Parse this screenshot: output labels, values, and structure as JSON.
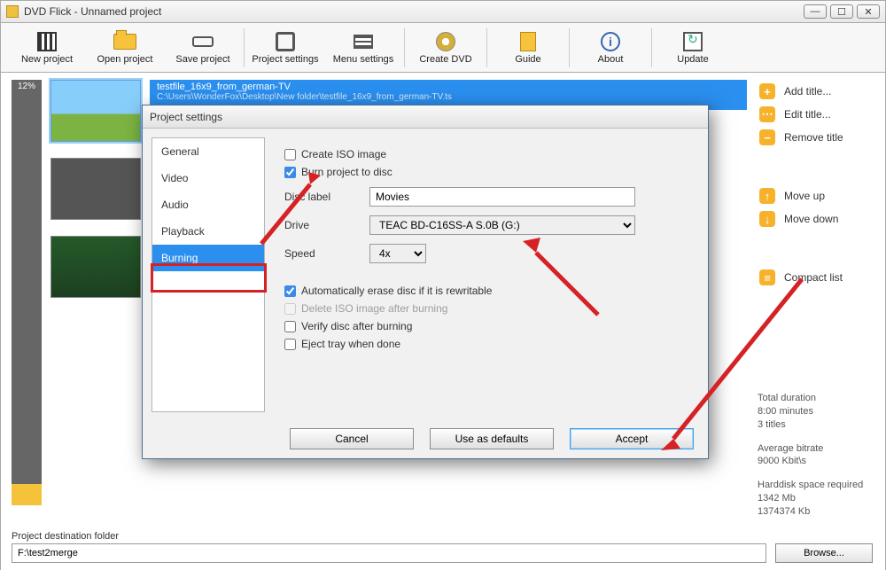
{
  "window": {
    "title": "DVD Flick - Unnamed project"
  },
  "toolbar": {
    "new": "New project",
    "open": "Open project",
    "save": "Save project",
    "projset": "Project settings",
    "menuset": "Menu settings",
    "create": "Create DVD",
    "guide": "Guide",
    "about": "About",
    "update": "Update"
  },
  "timeline": {
    "percent": "12%"
  },
  "selected_title": {
    "name": "testfile_16x9_from_german-TV",
    "path": "C:\\Users\\WonderFox\\Desktop\\New folder\\testfile_16x9_from_german-TV.ts"
  },
  "right": {
    "add": "Add title...",
    "edit": "Edit title...",
    "remove": "Remove title",
    "up": "Move up",
    "down": "Move down",
    "compact": "Compact list"
  },
  "stats": {
    "dur_h": "Total duration",
    "dur_v": "8:00 minutes",
    "titles": "3 titles",
    "br_h": "Average bitrate",
    "br_v": "9000 Kbit\\s",
    "hd_h": "Harddisk space required",
    "hd_v1": "1342 Mb",
    "hd_v2": "1374374 Kb"
  },
  "bottom": {
    "label": "Project destination folder",
    "value": "F:\\test2merge",
    "browse": "Browse..."
  },
  "dialog": {
    "title": "Project settings",
    "tabs": {
      "general": "General",
      "video": "Video",
      "audio": "Audio",
      "playback": "Playback",
      "burning": "Burning"
    },
    "create_iso": "Create ISO image",
    "burn_disc": "Burn project to disc",
    "disc_label": "Disc label",
    "disc_label_v": "Movies",
    "drive": "Drive",
    "drive_v": "TEAC BD-C16SS-A S.0B (G:)",
    "speed": "Speed",
    "speed_v": "4x",
    "auto_erase": "Automatically erase disc if it is rewritable",
    "del_iso": "Delete ISO image after burning",
    "verify": "Verify disc after burning",
    "eject": "Eject tray when done",
    "cancel": "Cancel",
    "defaults": "Use as defaults",
    "accept": "Accept"
  }
}
